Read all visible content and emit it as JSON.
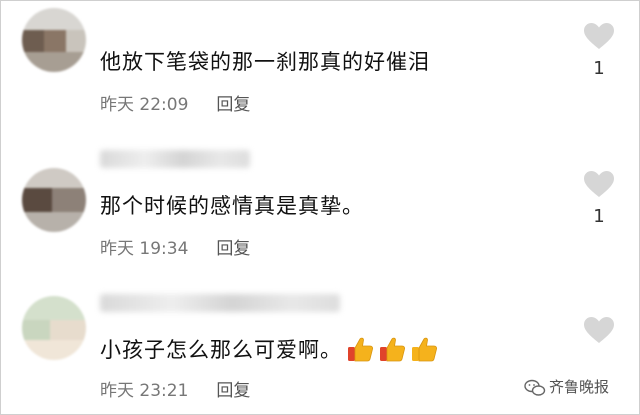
{
  "comments": [
    {
      "text": "他放下笔袋的那一刹那真的好催泪",
      "time": "昨天 22:09",
      "reply": "回复",
      "likes": "1",
      "emojis": []
    },
    {
      "text": "那个时候的感情真是真挚。",
      "time": "昨天 19:34",
      "reply": "回复",
      "likes": "1",
      "emojis": []
    },
    {
      "text": "小孩子怎么那么可爱啊。",
      "time": "昨天 23:21",
      "reply": "回复",
      "likes": "",
      "emojis": [
        "thumbs-up-icon",
        "thumbs-up-icon",
        "thumbs-up-icon"
      ]
    }
  ],
  "watermark": {
    "text": "齐鲁晚报",
    "icon": "wechat-icon"
  },
  "colors": {
    "heart": "#d6d6d6",
    "thumb": "#f5b21c",
    "cuff": "#e0432b"
  }
}
